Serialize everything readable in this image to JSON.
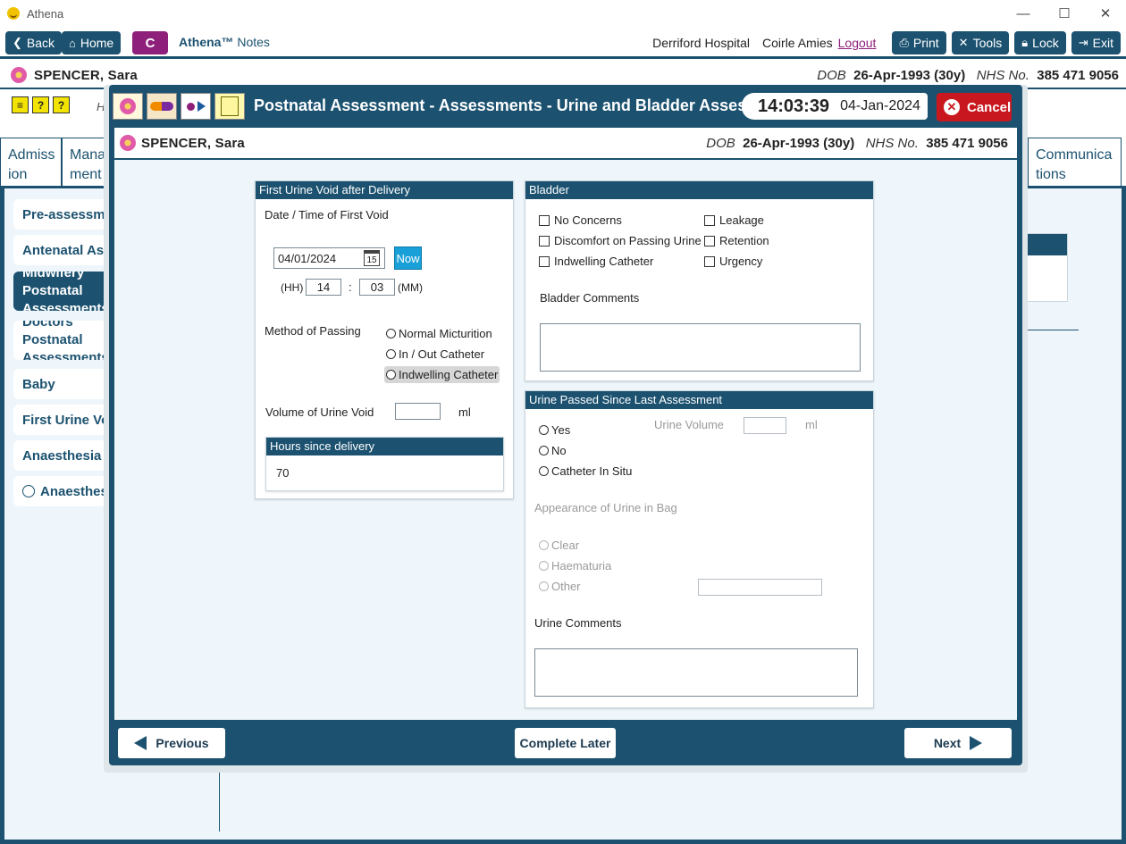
{
  "window": {
    "title": "Athena"
  },
  "toolbar": {
    "back": "Back",
    "home": "Home",
    "c": "C",
    "app_name": "Athena™",
    "notes": "Notes",
    "hospital": "Derriford Hospital",
    "user": "Coirle Amies",
    "logout": "Logout",
    "print": "Print",
    "tools": "Tools",
    "lock": "Lock",
    "exit": "Exit"
  },
  "patient": {
    "name": "SPENCER, Sara",
    "dob_label": "DOB",
    "dob": "26-Apr-1993 (30y)",
    "nhs_label": "NHS No.",
    "nhs": "385 471 9056"
  },
  "background": {
    "header_letter": "H",
    "tabs": [
      "Admiss ion",
      "Mana ment",
      "Communica tions"
    ],
    "sidebar": [
      "Pre-assessment",
      "Antenatal Assessments",
      "Midwifery Postnatal Assessments",
      "Doctors Postnatal Assessments",
      "Baby",
      "First Urine Void",
      "Anaesthesia In",
      "Anaesthesia"
    ]
  },
  "modal": {
    "title": "Postnatal Assessment - Assessments - Urine and Bladder Assessment",
    "time": "14:03:39",
    "date": "04-Jan-2024",
    "cancel": "Cancel"
  },
  "first_void": {
    "header": "First Urine Void after Delivery",
    "date_time_label": "Date / Time of First Void",
    "date_value": "04/01/2024",
    "calendar_day": "15",
    "now": "Now",
    "hh_label": "(HH)",
    "hh_value": "14",
    "sep": ":",
    "mm_value": "03",
    "mm_label": "(MM)",
    "method_label": "Method of Passing",
    "methods": [
      "Normal Micturition",
      "In / Out Catheter",
      "Indwelling Catheter"
    ],
    "volume_label": "Volume of Urine Void",
    "volume_value": "",
    "volume_unit": "ml",
    "hours_header": "Hours since delivery",
    "hours_value": "70"
  },
  "bladder": {
    "header": "Bladder",
    "checks_left": [
      "No Concerns",
      "Discomfort on Passing Urine",
      "Indwelling Catheter"
    ],
    "checks_right": [
      "Leakage",
      "Retention",
      "Urgency"
    ],
    "comments_label": "Bladder Comments",
    "comments_value": ""
  },
  "urine_passed": {
    "header": "Urine Passed Since Last Assessment",
    "options": [
      "Yes",
      "No",
      "Catheter In Situ"
    ],
    "volume_label": "Urine Volume",
    "volume_unit": "ml",
    "appearance_label": "Appearance of Urine in Bag",
    "appearance_options": [
      "Clear",
      "Haematuria",
      "Other"
    ],
    "comments_label": "Urine Comments",
    "comments_value": ""
  },
  "footer": {
    "previous": "Previous",
    "complete_later": "Complete Later",
    "next": "Next"
  }
}
